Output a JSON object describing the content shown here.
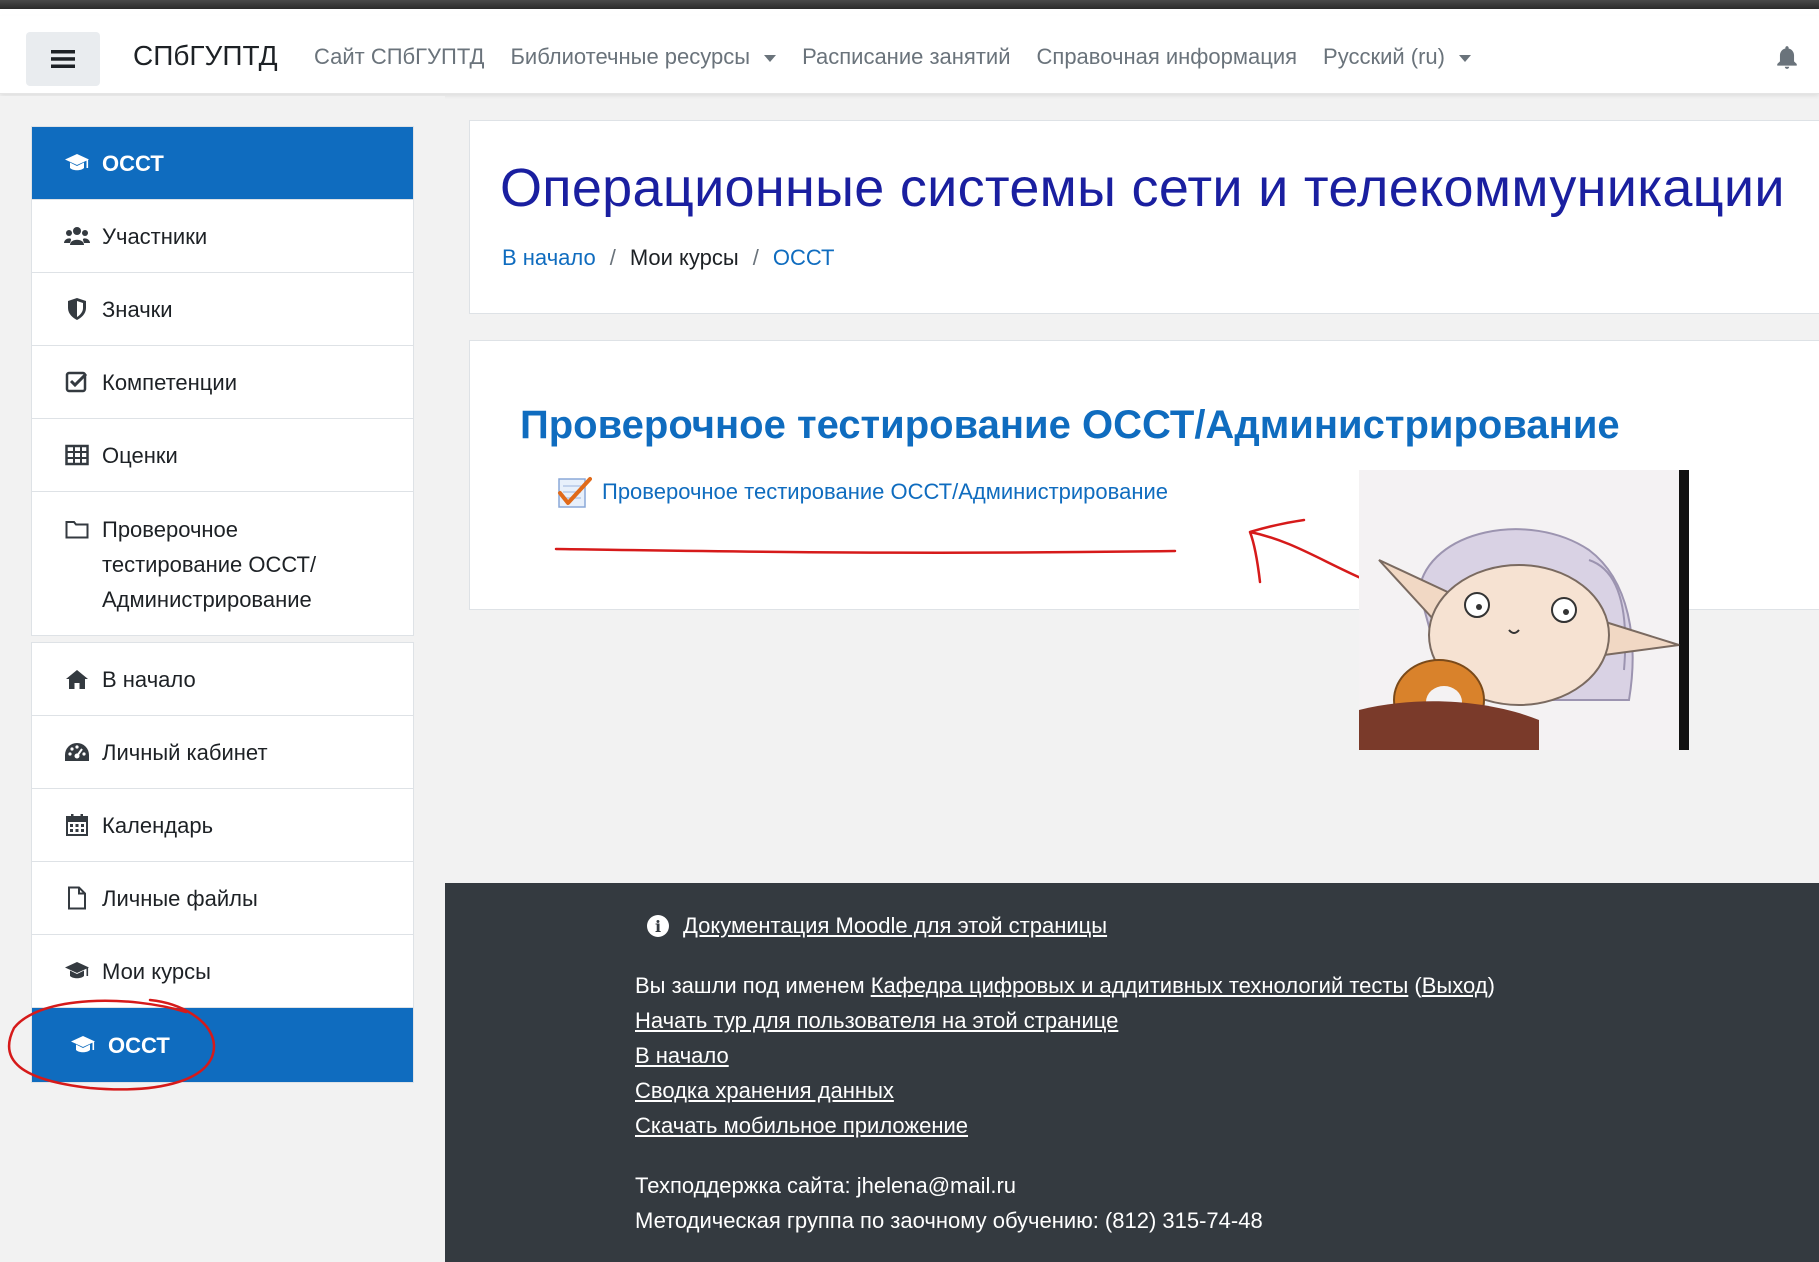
{
  "navbar": {
    "brand": "СПбГУПТД",
    "links": [
      {
        "label": "Сайт СПбГУПТД",
        "dropdown": false
      },
      {
        "label": "Библиотечные ресурсы",
        "dropdown": true
      },
      {
        "label": "Расписание занятий",
        "dropdown": false
      },
      {
        "label": "Справочная информация",
        "dropdown": false
      },
      {
        "label": "Русский (ru)",
        "dropdown": true
      }
    ],
    "icons": [
      "menu-icon",
      "bell-icon"
    ]
  },
  "sidebar": {
    "course_block": [
      {
        "label": "ОССТ",
        "icon": "graduation-cap-icon",
        "active": true
      },
      {
        "label": "Участники",
        "icon": "users-icon"
      },
      {
        "label": "Значки",
        "icon": "shield-icon"
      },
      {
        "label": "Компетенции",
        "icon": "check-square-icon"
      },
      {
        "label": "Оценки",
        "icon": "table-icon"
      },
      {
        "label_lines": [
          "Проверочное",
          "тестирование ОССТ/",
          "Администрирование"
        ],
        "icon": "folder-icon"
      }
    ],
    "site_block": [
      {
        "label": "В начало",
        "icon": "home-icon"
      },
      {
        "label": "Личный кабинет",
        "icon": "dashboard-icon"
      },
      {
        "label": "Календарь",
        "icon": "calendar-icon"
      },
      {
        "label": "Личные файлы",
        "icon": "file-icon"
      },
      {
        "label": "Мои курсы",
        "icon": "graduation-cap-icon"
      },
      {
        "label": "ОССТ",
        "icon": "graduation-cap-icon",
        "active": true
      }
    ]
  },
  "header": {
    "title": "Операционные системы сети и телекоммуникации",
    "breadcrumb": [
      "В начало",
      "Мои курсы",
      "ОССТ"
    ]
  },
  "section": {
    "title": "Проверочное тестирование ОССТ/Администрирование",
    "activity": "Проверочное тестирование ОССТ/Администрирование"
  },
  "footer": {
    "docs_link": "Документация Moodle для этой страницы",
    "logged_in_prefix": "Вы зашли под именем ",
    "user_name": "Кафедра цифровых и аддитивных технологий тесты",
    "logout": "Выход",
    "tour": "Начать тур для пользователя на этой странице",
    "home": "В начало",
    "data_summary": "Сводка хранения данных",
    "mobile_app": "Скачать мобильное приложение",
    "support": "Техподдержка сайта: jhelena@mail.ru",
    "method_group": "Методическая группа по заочному обучению: (812) 315-74-48"
  },
  "colors": {
    "accent": "#0f6cbf",
    "title": "#1a1fa0",
    "footer_bg": "#343a40",
    "annotation": "#d61a1a"
  }
}
